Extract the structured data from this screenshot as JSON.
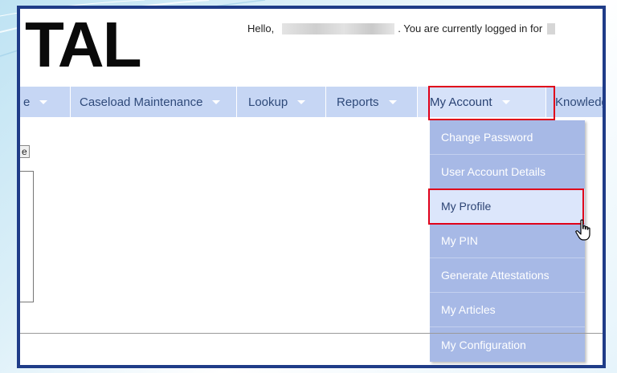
{
  "header": {
    "logo_text": "TAL",
    "greeting_prefix": "Hello,",
    "greeting_suffix": ". You are currently logged in for"
  },
  "navbar": {
    "items": [
      {
        "label": "e"
      },
      {
        "label": "Caseload Maintenance"
      },
      {
        "label": "Lookup"
      },
      {
        "label": "Reports"
      },
      {
        "label": "My Account"
      },
      {
        "label": "Knowledg"
      }
    ]
  },
  "dropdown": {
    "items": [
      {
        "label": "Change Password"
      },
      {
        "label": "User Account Details"
      },
      {
        "label": "My Profile"
      },
      {
        "label": "My PIN"
      },
      {
        "label": "Generate Attestations"
      },
      {
        "label": "My Articles"
      },
      {
        "label": "My Configuration"
      }
    ]
  },
  "page": {
    "small_button_label": "e"
  },
  "colors": {
    "frame_border": "#1f3c88",
    "navbar_bg": "#c6d6f4",
    "dropdown_bg": "#a7b9e6",
    "highlight_red": "#e0001a"
  },
  "icons": {
    "caret": "caret-down-icon",
    "cursor": "hand-pointer-icon"
  }
}
